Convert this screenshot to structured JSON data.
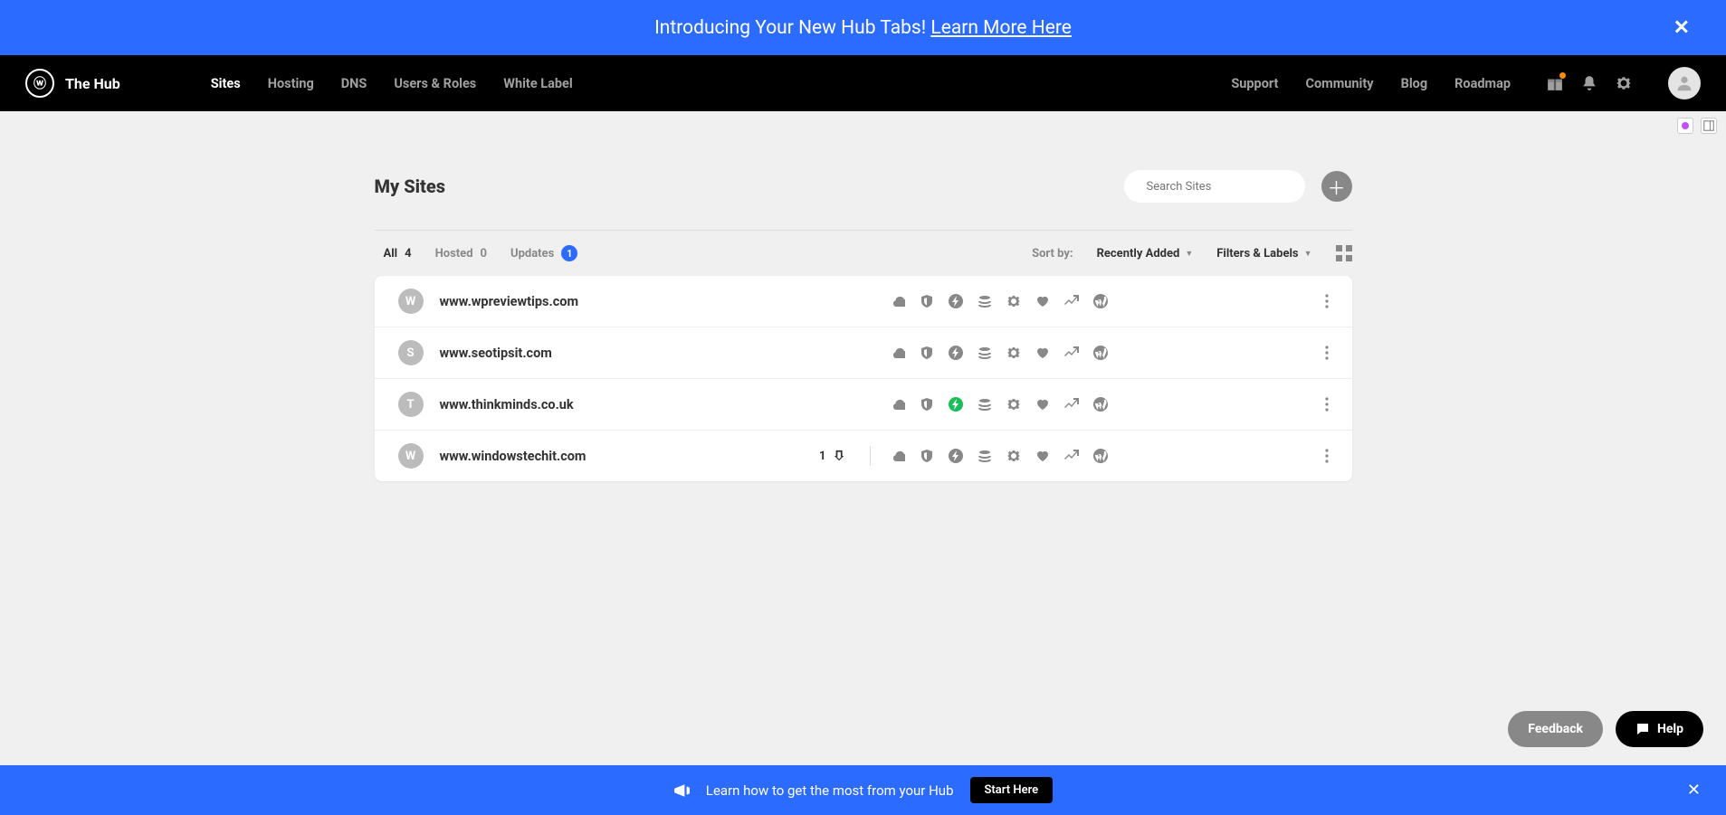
{
  "announcement": {
    "text": "Introducing Your New Hub Tabs! ",
    "link": "Learn More Here"
  },
  "brand": "The Hub",
  "nav": {
    "primary": [
      "Sites",
      "Hosting",
      "DNS",
      "Users & Roles",
      "White Label"
    ],
    "active": "Sites",
    "secondary": [
      "Support",
      "Community",
      "Blog",
      "Roadmap"
    ]
  },
  "page": {
    "title": "My Sites",
    "search_placeholder": "Search Sites"
  },
  "filters": {
    "all_label": "All",
    "all_count": "4",
    "hosted_label": "Hosted",
    "hosted_count": "0",
    "updates_label": "Updates",
    "updates_count": "1",
    "sort_label": "Sort by:",
    "sort_value": "Recently Added",
    "filters_label": "Filters & Labels"
  },
  "sites": [
    {
      "letter": "W",
      "url": "www.wpreviewtips.com",
      "updates": null,
      "bolt_green": false
    },
    {
      "letter": "S",
      "url": "www.seotipsit.com",
      "updates": null,
      "bolt_green": false
    },
    {
      "letter": "T",
      "url": "www.thinkminds.co.uk",
      "updates": null,
      "bolt_green": true
    },
    {
      "letter": "W",
      "url": "www.windowstechit.com",
      "updates": "1",
      "bolt_green": false
    }
  ],
  "feedback_label": "Feedback",
  "help_label": "Help",
  "bottom": {
    "text": "Learn how to get the most from your Hub",
    "button": "Start Here"
  }
}
